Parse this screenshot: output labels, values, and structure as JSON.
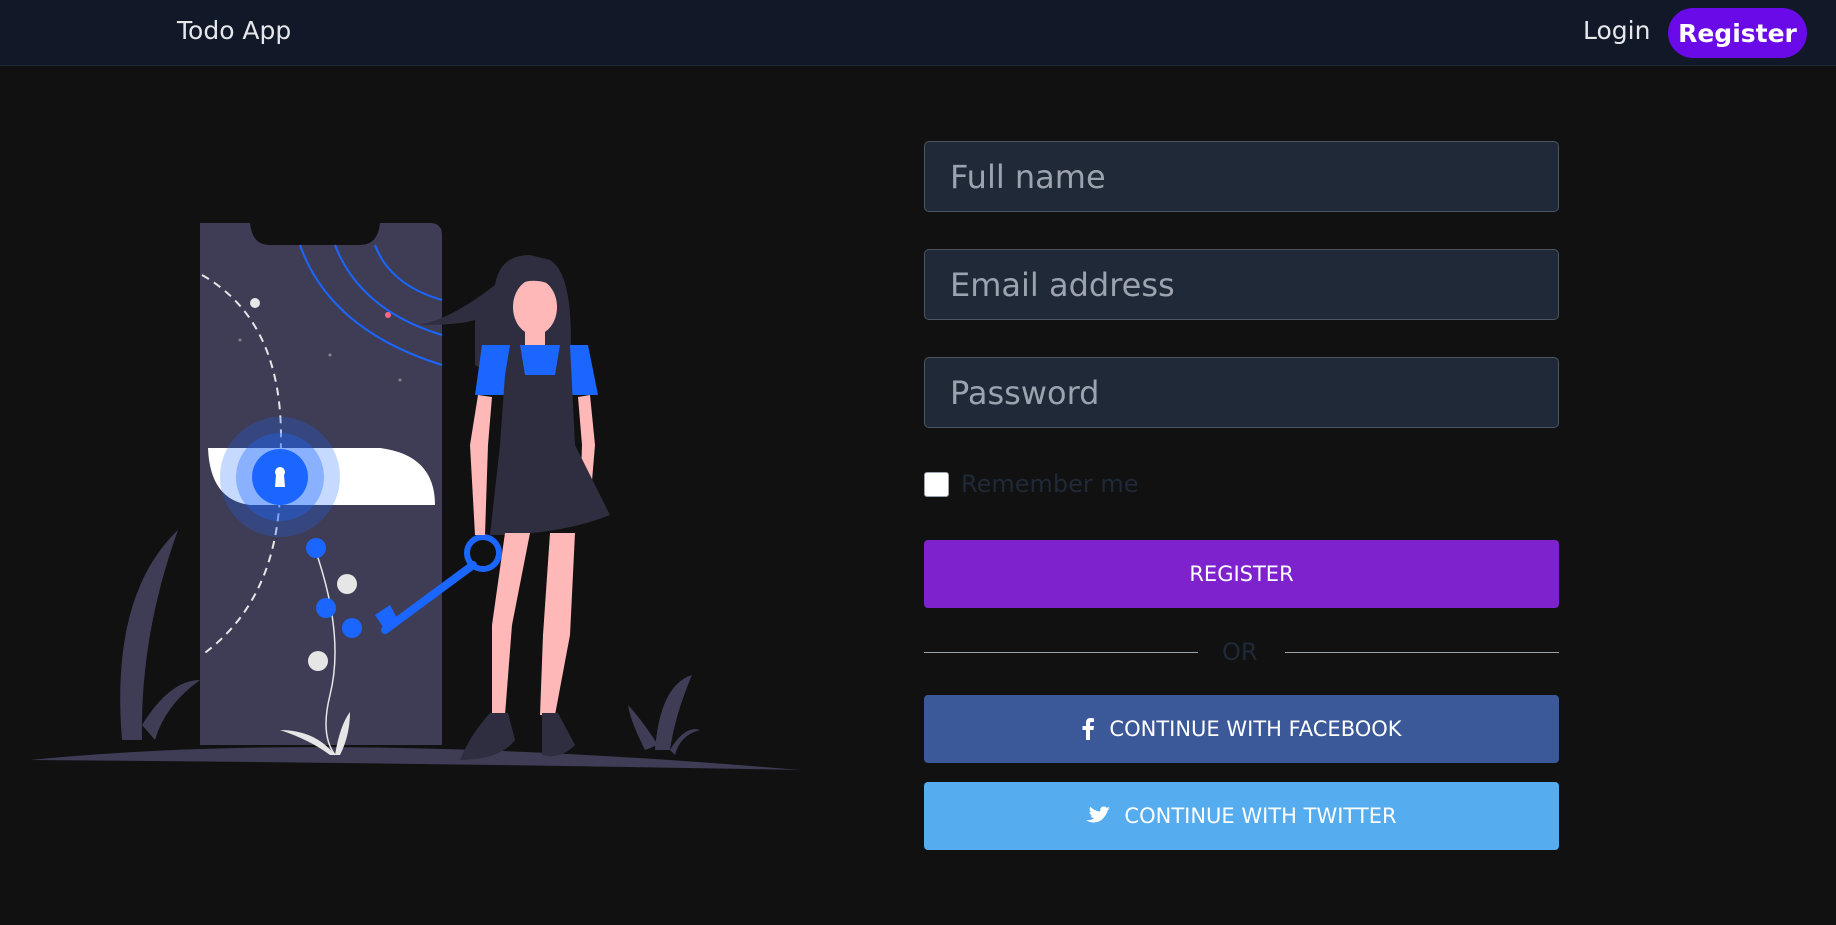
{
  "navbar": {
    "brand": "Todo App",
    "login_label": "Login",
    "register_label": "Register"
  },
  "form": {
    "fullname_placeholder": "Full name",
    "email_placeholder": "Email address",
    "password_placeholder": "Password",
    "remember_label": "Remember me",
    "remember_checked": false,
    "submit_label": "REGISTER",
    "divider_text": "OR",
    "facebook_label": "CONTINUE WITH FACEBOOK",
    "twitter_label": "CONTINUE WITH TWITTER"
  },
  "colors": {
    "background": "#111111",
    "navbar": "#111827",
    "brand_accent": "#6b0ae8",
    "submit": "#7e22ce",
    "facebook": "#3b5998",
    "twitter": "#55acee",
    "illustration_accent": "#1a66ff"
  },
  "icons": {
    "facebook": "facebook-icon",
    "twitter": "twitter-icon",
    "illustration": "login-illustration"
  }
}
